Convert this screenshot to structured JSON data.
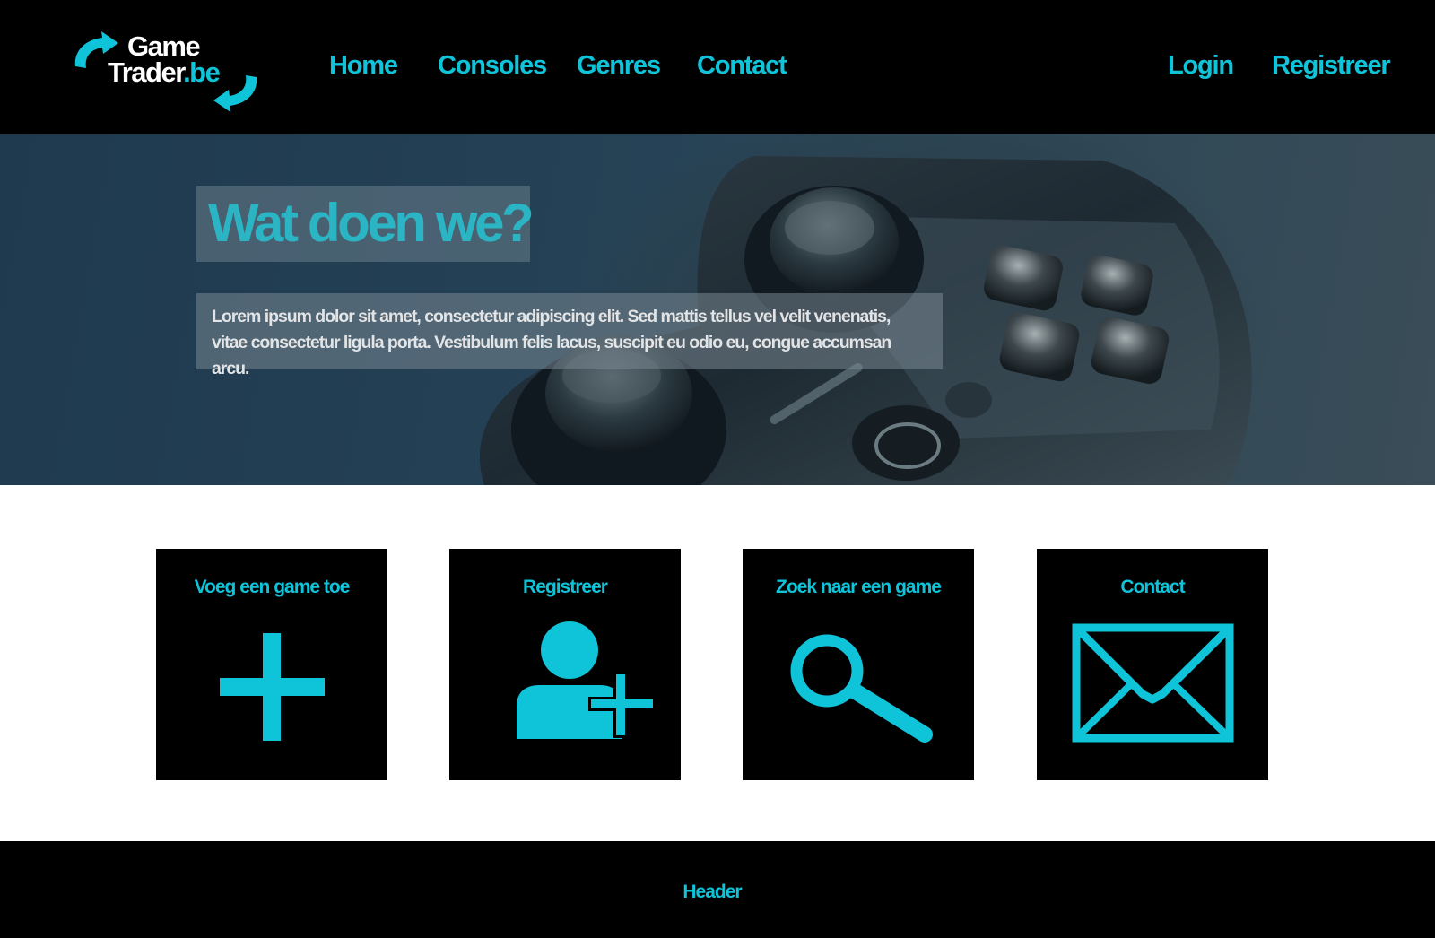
{
  "brand": {
    "line1": "Game",
    "line2_main": "Trader",
    "line2_suffix": ".be",
    "accent_color": "#0fc3d8"
  },
  "nav": {
    "left": [
      "Home",
      "Consoles",
      "Genres",
      "Contact"
    ],
    "right": [
      "Login",
      "Registreer"
    ]
  },
  "hero": {
    "title": "Wat doen we?",
    "text": "Lorem ipsum dolor sit amet, consectetur adipiscing elit. Sed mattis tellus vel velit venenatis, vitae consectetur ligula porta. Vestibulum felis lacus, suscipit eu odio eu, congue accumsan arcu."
  },
  "tiles": [
    {
      "label": "Voeg een game toe",
      "icon": "plus-icon"
    },
    {
      "label": "Registreer",
      "icon": "add-user-icon"
    },
    {
      "label": "Zoek naar een game",
      "icon": "search-icon"
    },
    {
      "label": "Contact",
      "icon": "envelope-icon"
    }
  ],
  "footer": {
    "text": "Header"
  }
}
